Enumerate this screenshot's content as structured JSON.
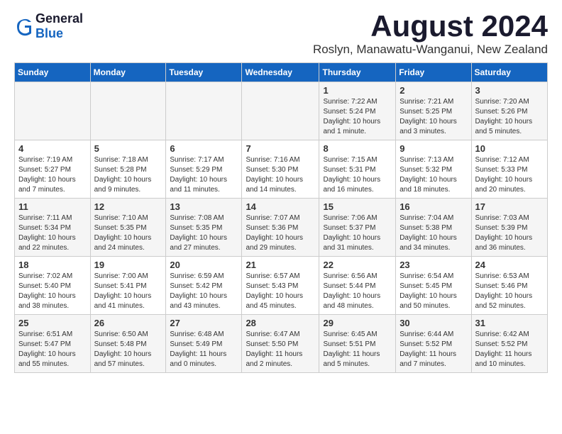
{
  "header": {
    "logo_general": "General",
    "logo_blue": "Blue",
    "title": "August 2024",
    "subtitle": "Roslyn, Manawatu-Wanganui, New Zealand"
  },
  "calendar": {
    "days_of_week": [
      "Sunday",
      "Monday",
      "Tuesday",
      "Wednesday",
      "Thursday",
      "Friday",
      "Saturday"
    ],
    "weeks": [
      [
        {
          "day": "",
          "info": ""
        },
        {
          "day": "",
          "info": ""
        },
        {
          "day": "",
          "info": ""
        },
        {
          "day": "",
          "info": ""
        },
        {
          "day": "1",
          "info": "Sunrise: 7:22 AM\nSunset: 5:24 PM\nDaylight: 10 hours\nand 1 minute."
        },
        {
          "day": "2",
          "info": "Sunrise: 7:21 AM\nSunset: 5:25 PM\nDaylight: 10 hours\nand 3 minutes."
        },
        {
          "day": "3",
          "info": "Sunrise: 7:20 AM\nSunset: 5:26 PM\nDaylight: 10 hours\nand 5 minutes."
        }
      ],
      [
        {
          "day": "4",
          "info": "Sunrise: 7:19 AM\nSunset: 5:27 PM\nDaylight: 10 hours\nand 7 minutes."
        },
        {
          "day": "5",
          "info": "Sunrise: 7:18 AM\nSunset: 5:28 PM\nDaylight: 10 hours\nand 9 minutes."
        },
        {
          "day": "6",
          "info": "Sunrise: 7:17 AM\nSunset: 5:29 PM\nDaylight: 10 hours\nand 11 minutes."
        },
        {
          "day": "7",
          "info": "Sunrise: 7:16 AM\nSunset: 5:30 PM\nDaylight: 10 hours\nand 14 minutes."
        },
        {
          "day": "8",
          "info": "Sunrise: 7:15 AM\nSunset: 5:31 PM\nDaylight: 10 hours\nand 16 minutes."
        },
        {
          "day": "9",
          "info": "Sunrise: 7:13 AM\nSunset: 5:32 PM\nDaylight: 10 hours\nand 18 minutes."
        },
        {
          "day": "10",
          "info": "Sunrise: 7:12 AM\nSunset: 5:33 PM\nDaylight: 10 hours\nand 20 minutes."
        }
      ],
      [
        {
          "day": "11",
          "info": "Sunrise: 7:11 AM\nSunset: 5:34 PM\nDaylight: 10 hours\nand 22 minutes."
        },
        {
          "day": "12",
          "info": "Sunrise: 7:10 AM\nSunset: 5:35 PM\nDaylight: 10 hours\nand 24 minutes."
        },
        {
          "day": "13",
          "info": "Sunrise: 7:08 AM\nSunset: 5:35 PM\nDaylight: 10 hours\nand 27 minutes."
        },
        {
          "day": "14",
          "info": "Sunrise: 7:07 AM\nSunset: 5:36 PM\nDaylight: 10 hours\nand 29 minutes."
        },
        {
          "day": "15",
          "info": "Sunrise: 7:06 AM\nSunset: 5:37 PM\nDaylight: 10 hours\nand 31 minutes."
        },
        {
          "day": "16",
          "info": "Sunrise: 7:04 AM\nSunset: 5:38 PM\nDaylight: 10 hours\nand 34 minutes."
        },
        {
          "day": "17",
          "info": "Sunrise: 7:03 AM\nSunset: 5:39 PM\nDaylight: 10 hours\nand 36 minutes."
        }
      ],
      [
        {
          "day": "18",
          "info": "Sunrise: 7:02 AM\nSunset: 5:40 PM\nDaylight: 10 hours\nand 38 minutes."
        },
        {
          "day": "19",
          "info": "Sunrise: 7:00 AM\nSunset: 5:41 PM\nDaylight: 10 hours\nand 41 minutes."
        },
        {
          "day": "20",
          "info": "Sunrise: 6:59 AM\nSunset: 5:42 PM\nDaylight: 10 hours\nand 43 minutes."
        },
        {
          "day": "21",
          "info": "Sunrise: 6:57 AM\nSunset: 5:43 PM\nDaylight: 10 hours\nand 45 minutes."
        },
        {
          "day": "22",
          "info": "Sunrise: 6:56 AM\nSunset: 5:44 PM\nDaylight: 10 hours\nand 48 minutes."
        },
        {
          "day": "23",
          "info": "Sunrise: 6:54 AM\nSunset: 5:45 PM\nDaylight: 10 hours\nand 50 minutes."
        },
        {
          "day": "24",
          "info": "Sunrise: 6:53 AM\nSunset: 5:46 PM\nDaylight: 10 hours\nand 52 minutes."
        }
      ],
      [
        {
          "day": "25",
          "info": "Sunrise: 6:51 AM\nSunset: 5:47 PM\nDaylight: 10 hours\nand 55 minutes."
        },
        {
          "day": "26",
          "info": "Sunrise: 6:50 AM\nSunset: 5:48 PM\nDaylight: 10 hours\nand 57 minutes."
        },
        {
          "day": "27",
          "info": "Sunrise: 6:48 AM\nSunset: 5:49 PM\nDaylight: 11 hours\nand 0 minutes."
        },
        {
          "day": "28",
          "info": "Sunrise: 6:47 AM\nSunset: 5:50 PM\nDaylight: 11 hours\nand 2 minutes."
        },
        {
          "day": "29",
          "info": "Sunrise: 6:45 AM\nSunset: 5:51 PM\nDaylight: 11 hours\nand 5 minutes."
        },
        {
          "day": "30",
          "info": "Sunrise: 6:44 AM\nSunset: 5:52 PM\nDaylight: 11 hours\nand 7 minutes."
        },
        {
          "day": "31",
          "info": "Sunrise: 6:42 AM\nSunset: 5:52 PM\nDaylight: 11 hours\nand 10 minutes."
        }
      ]
    ]
  }
}
